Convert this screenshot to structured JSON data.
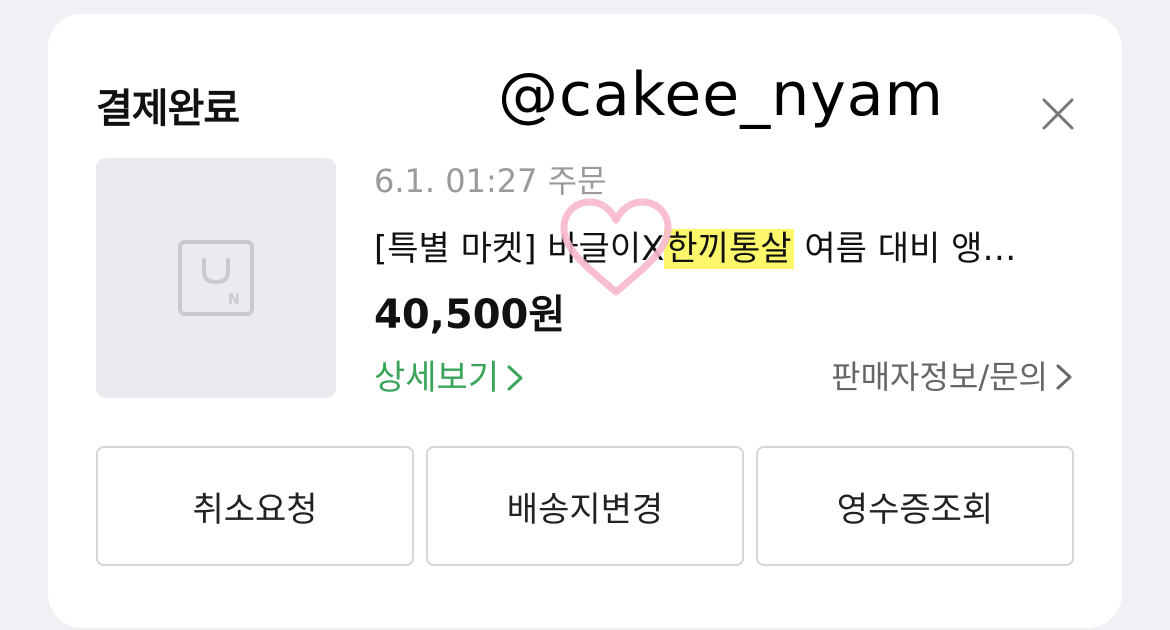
{
  "modal": {
    "title": "결제완료",
    "watermark": "@cakee_nyam",
    "close_icon": "close-icon"
  },
  "order": {
    "date_text": "6.1. 01:27 주문",
    "product_name_prefix": "[특별 마켓] 바글이X",
    "product_name_highlight": "한끼통살",
    "product_name_suffix": " 여름 대비 앵…",
    "price": "40,500원",
    "detail_link": "상세보기",
    "seller_link": "판매자정보/문의",
    "highlight_color": "#fdf86b",
    "detail_color": "#3aa55a"
  },
  "actions": {
    "cancel_request": "취소요청",
    "change_address": "배송지변경",
    "receipt": "영수증조회"
  },
  "decoration": {
    "heart_icon": "heart-outline-icon",
    "heart_color": "#f6b7cf"
  }
}
